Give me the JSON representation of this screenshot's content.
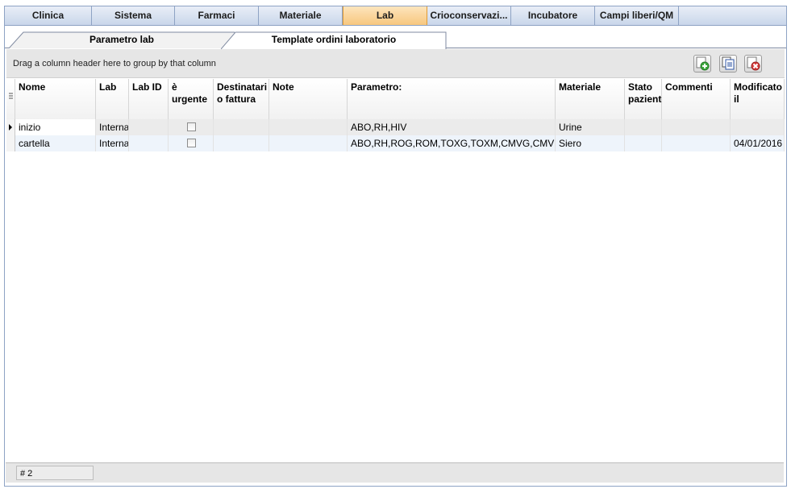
{
  "main_tabs": [
    {
      "label": "Clinica",
      "active": false
    },
    {
      "label": "Sistema",
      "active": false
    },
    {
      "label": "Farmaci",
      "active": false
    },
    {
      "label": "Materiale",
      "active": false
    },
    {
      "label": "Lab",
      "active": true
    },
    {
      "label": "Crioconservazi...",
      "active": false
    },
    {
      "label": "Incubatore",
      "active": false
    },
    {
      "label": "Campi liberi/QM",
      "active": false
    }
  ],
  "sub_tabs": [
    {
      "label": "Parametro lab",
      "active": false
    },
    {
      "label": "Template ordini laboratorio",
      "active": true
    }
  ],
  "group_hint": "Drag a column header here to group by that column",
  "toolbar": {
    "add_icon": "add-icon",
    "copy_icon": "copy-icon",
    "delete_icon": "delete-icon"
  },
  "columns": [
    "Nome",
    "Lab",
    "Lab ID",
    "è urgente",
    "Destinatari o fattura",
    "Note",
    "Parametro:",
    "Materiale",
    "Stato paziente",
    "Commenti",
    "Modificato il"
  ],
  "rows": [
    {
      "nome": "inizio",
      "lab": "Interna",
      "lab_id": "",
      "urgente": false,
      "destinatario": "",
      "note": "",
      "parametro": "ABO,RH,HIV",
      "materiale": "Urine",
      "stato": "",
      "commenti": "",
      "modificato": ""
    },
    {
      "nome": "cartella",
      "lab": "Interna",
      "lab_id": "",
      "urgente": false,
      "destinatario": "",
      "note": "",
      "parametro": "ABO,RH,ROG,ROM,TOXG,TOXM,CMVG,CMVM,",
      "materiale": "Siero",
      "stato": "",
      "commenti": "",
      "modificato": "04/01/2016"
    }
  ],
  "footer": {
    "count": "# 2"
  },
  "colors": {
    "active_tab": "#f7c77e",
    "row_alt": "#eef4fb"
  }
}
